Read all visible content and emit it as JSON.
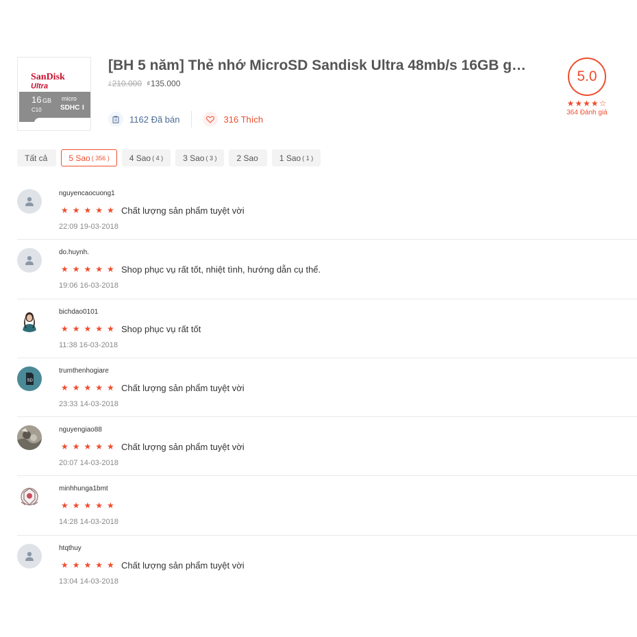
{
  "product": {
    "title": "[BH 5 năm] Thẻ nhớ MicroSD Sandisk Ultra 48mb/s 16GB g…",
    "currency": "₫",
    "price_old": "210.000",
    "price_new": "135.000",
    "sold": "1162 Đã bán",
    "likes": "316 Thích",
    "image_text": {
      "brand": "SanDisk",
      "line": "Ultra",
      "capacity": "16",
      "unit": "GB",
      "class": "C10",
      "micro": "micro",
      "sdhc": "SDHC",
      "uhs": "I"
    }
  },
  "rating": {
    "score": "5.0",
    "stars": "★★★★☆",
    "count_label": "364 Đánh giá",
    "accent_color": "#ee4d2d"
  },
  "filters": [
    {
      "label": "Tất cả",
      "count": ""
    },
    {
      "label": "5 Sao",
      "count": "( 356 )",
      "active": true
    },
    {
      "label": "4 Sao",
      "count": "( 4 )"
    },
    {
      "label": "3 Sao",
      "count": "( 3 )"
    },
    {
      "label": "2 Sao",
      "count": ""
    },
    {
      "label": "1 Sao",
      "count": "( 1 )"
    }
  ],
  "reviews": [
    {
      "username": "nguyencaocuong1",
      "stars": "★★★★★",
      "comment": "Chất lượng sản phẩm tuyệt vời",
      "time": "22:09 19-03-2018",
      "avatar": "default-avatar-icon"
    },
    {
      "username": "do.huynh.",
      "stars": "★★★★★",
      "comment": "Shop phục vụ rất tốt, nhiệt tình, hướng dẫn cụ thể.",
      "time": "19:06 16-03-2018",
      "avatar": "default-avatar-icon"
    },
    {
      "username": "bichdao0101",
      "stars": "★★★★★",
      "comment": "Shop phục vụ rất tốt",
      "time": "11:38 16-03-2018",
      "avatar": "photo-avatar"
    },
    {
      "username": "trumthenhogiare",
      "stars": "★★★★★",
      "comment": "Chất lượng sản phẩm tuyệt vời",
      "time": "23:33 14-03-2018",
      "avatar": "sd-card-avatar"
    },
    {
      "username": "nguyengiao88",
      "stars": "★★★★★",
      "comment": "Chất lượng sản phẩm tuyệt vời",
      "time": "20:07 14-03-2018",
      "avatar": "photo-avatar"
    },
    {
      "username": "minhhunga1bmt",
      "stars": "★★★★★",
      "comment": "",
      "time": "14:28 14-03-2018",
      "avatar": "emblem-avatar"
    },
    {
      "username": "htqthuy",
      "stars": "★★★★★",
      "comment": "Chất lượng sản phẩm tuyệt vời",
      "time": "13:04 14-03-2018",
      "avatar": "default-avatar-icon"
    }
  ]
}
